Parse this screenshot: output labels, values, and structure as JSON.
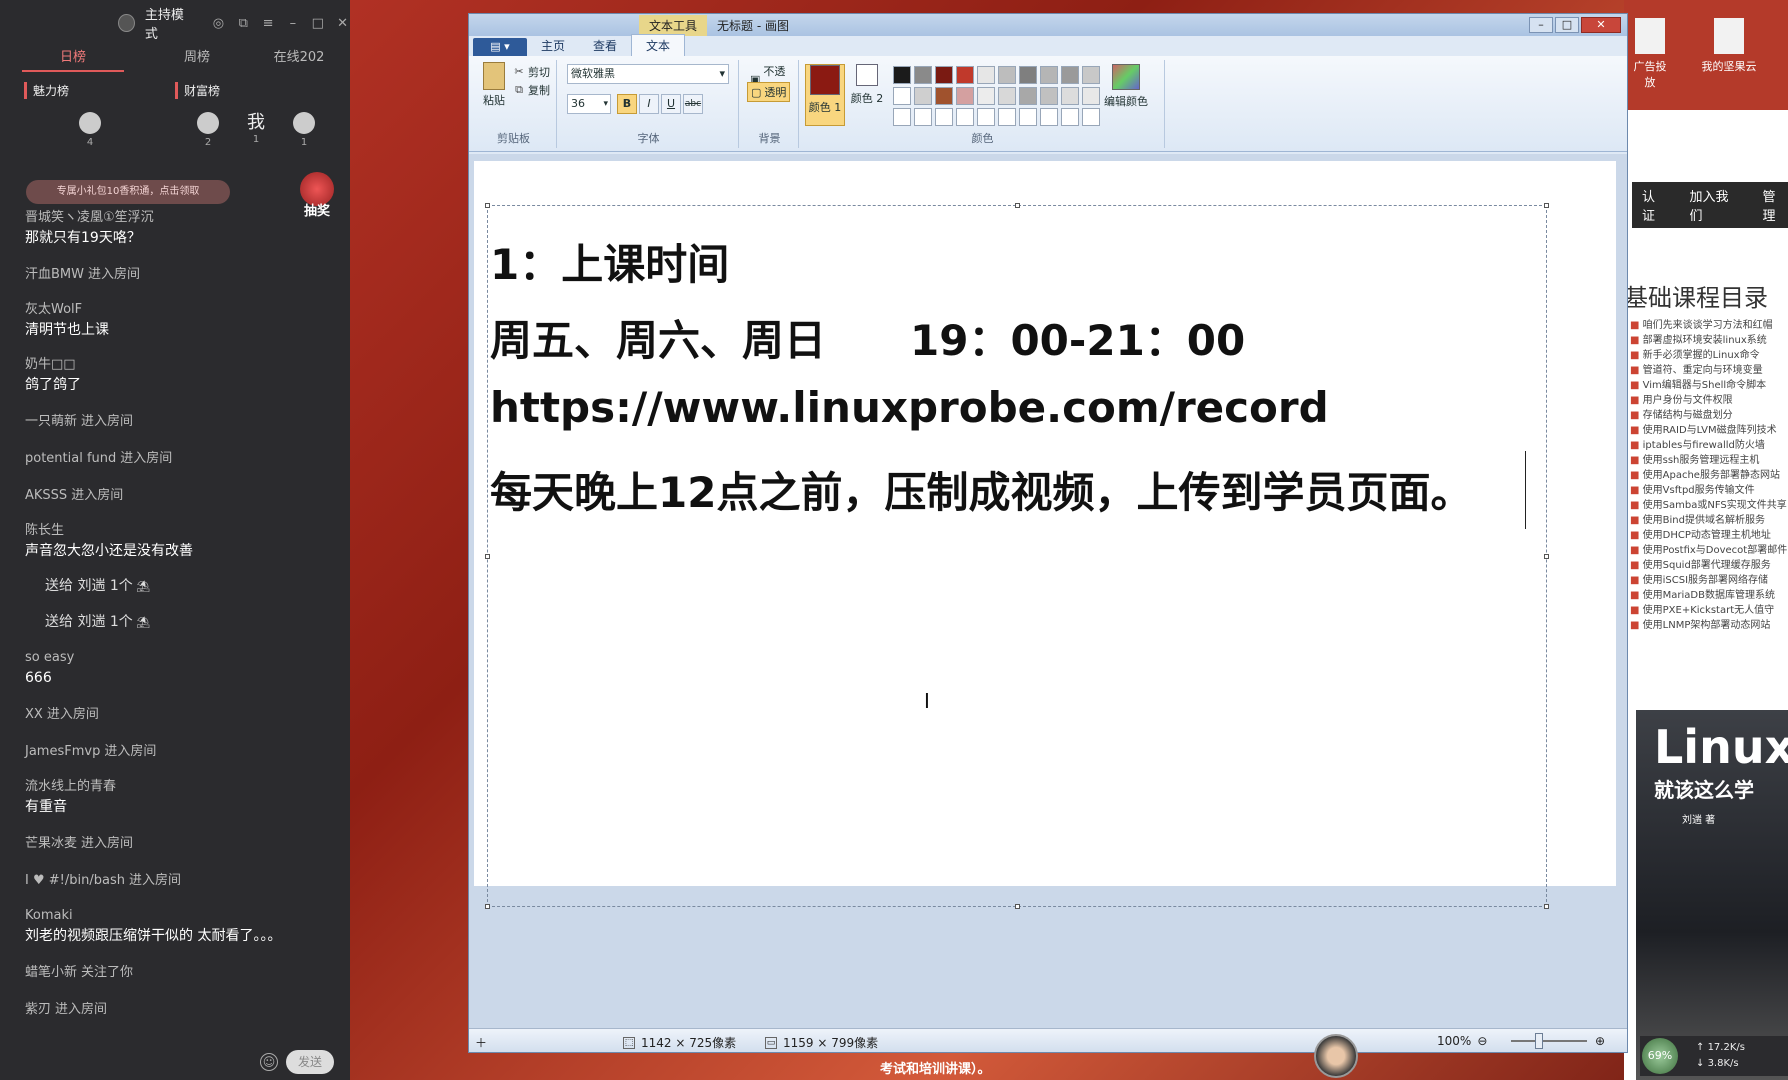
{
  "chat": {
    "mode_label": "主持模式",
    "tabs": [
      "日榜",
      "周榜",
      "在线202"
    ],
    "rank_heads": [
      "魅力榜",
      "财富榜"
    ],
    "rank_counts": [
      "4",
      "2",
      "1",
      "1"
    ],
    "me_label": "我",
    "notice": "专属小礼包10香积通，点击领取",
    "lottery_label": "抽奖",
    "send_label": "发送",
    "messages": [
      {
        "type": "msg",
        "name": "晋城笑ヽ凌凰①笙浮沉",
        "text": "那就只有19天咯？"
      },
      {
        "type": "enter",
        "name": "汗血BMW",
        "action": "进入房间"
      },
      {
        "type": "msg",
        "name": "灰太WolF",
        "text": "清明节也上课"
      },
      {
        "type": "msg",
        "name": "奶牛□□",
        "text": "鸽了鸽了"
      },
      {
        "type": "enter",
        "name": "一只萌新",
        "action": "进入房间"
      },
      {
        "type": "enter",
        "name": "potential fund",
        "action": "进入房间"
      },
      {
        "type": "enter",
        "name": "AKSSS",
        "action": "进入房间"
      },
      {
        "type": "msg",
        "name": "陈长生",
        "text": "声音忽大忽小还是没有改善"
      },
      {
        "type": "gift",
        "text": "送给 刘遄 1个"
      },
      {
        "type": "gift",
        "text": "送给 刘遄 1个"
      },
      {
        "type": "msg",
        "name": "so easy",
        "text": "666"
      },
      {
        "type": "enter",
        "name": "XX",
        "action": "进入房间"
      },
      {
        "type": "enter",
        "name": "JamesFmvp",
        "action": "进入房间"
      },
      {
        "type": "msg",
        "name": "流水线上的青春",
        "text": "有重音"
      },
      {
        "type": "enter",
        "name": "芒果冰麦",
        "action": "进入房间"
      },
      {
        "type": "enter",
        "name": "I ♥ #!/bin/bash",
        "action": "进入房间"
      },
      {
        "type": "msg",
        "name": "Komaki",
        "text": "刘老的视频跟压缩饼干似的 太耐看了。。。"
      },
      {
        "type": "enter",
        "name": "蜡笔小新",
        "action": "关注了你"
      },
      {
        "type": "enter",
        "name": "紫刃",
        "action": "进入房间"
      }
    ]
  },
  "paint": {
    "title": "无标题 - 画图",
    "context_tab": "文本工具",
    "tabs": [
      "主页",
      "查看",
      "文本"
    ],
    "clipboard": {
      "paste": "粘贴",
      "cut": "剪切",
      "copy": "复制",
      "group": "剪贴板"
    },
    "font": {
      "family": "微软雅黑",
      "size": "36",
      "bold": "B",
      "italic": "I",
      "underline": "U",
      "strike": "abc",
      "group": "字体"
    },
    "background": {
      "opaque": "不透明",
      "transparent": "透明",
      "group": "背景"
    },
    "colors": {
      "color1": "颜色 1",
      "color2": "颜色 2",
      "edit": "编辑颜色",
      "group": "颜色",
      "color1_hex": "#8b1a12",
      "color2_hex": "#ffffff"
    },
    "canvas_text": {
      "line1": "1：上课时间",
      "line2_days": "周五、周六、周日",
      "line2_time": "19：00-21：00",
      "line3": "https://www.linuxprobe.com/record",
      "line4": "每天晚上12点之前，压制成视频，上传到学员页面。"
    },
    "status": {
      "selection_size": "1142 × 725像素",
      "canvas_size": "1159 × 799像素",
      "zoom": "100%"
    }
  },
  "browser": {
    "top_icons": [
      "广告投放",
      "我的坚果云"
    ],
    "nav_items": [
      "认证",
      "加入我们",
      "管理"
    ],
    "course_title": "基础课程目录",
    "course_items": [
      "咱们先来谈谈学习方法和红帽",
      "部署虚拟环境安装linux系统",
      "新手必须掌握的Linux命令",
      "管道符、重定向与环境变量",
      "Vim编辑器与Shell命令脚本",
      "用户身份与文件权限",
      "存储结构与磁盘划分",
      "使用RAID与LVM磁盘阵列技术",
      "iptables与firewalld防火墙",
      "使用ssh服务管理远程主机",
      "使用Apache服务部署静态网站",
      "使用Vsftpd服务传输文件",
      "使用Samba或NFS实现文件共享",
      "使用Bind提供域名解析服务",
      "使用DHCP动态管理主机地址",
      "使用Postfix与Dovecot部署邮件",
      "使用Squid部署代理缓存服务",
      "使用iSCSI服务部署网络存储",
      "使用MariaDB数据库管理系统",
      "使用PXE+Kickstart无人值守",
      "使用LNMP架构部署动态网站"
    ],
    "book_title": "Linux",
    "book_subtitle": "就该这么学",
    "book_author": "刘遄 著"
  },
  "overlay": {
    "net_percent": "69%",
    "net_up": "17.2K/s",
    "net_down": "3.8K/s",
    "bottom_sub": "考试和培训讲课）。"
  }
}
